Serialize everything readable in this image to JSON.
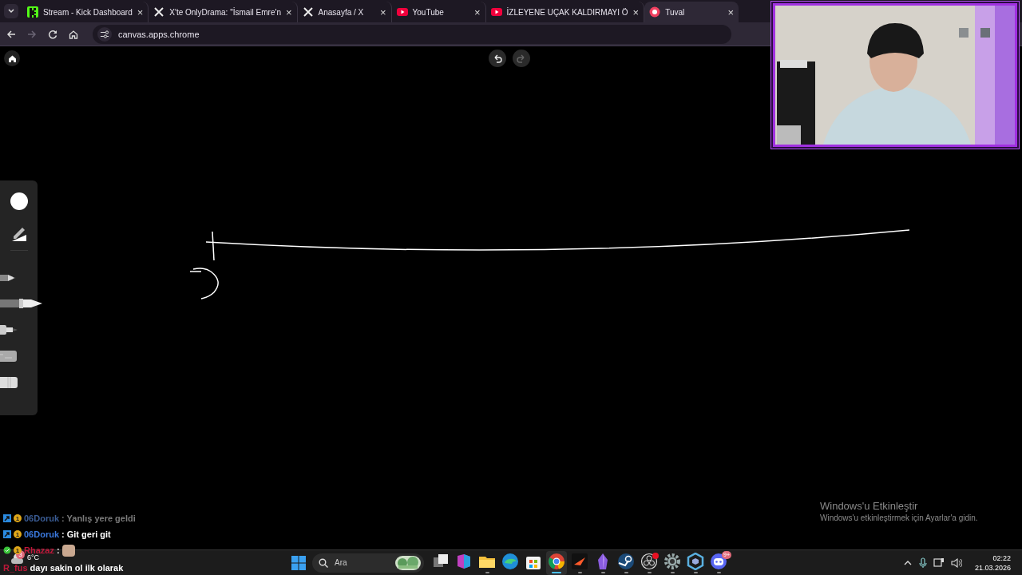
{
  "browser": {
    "tabs": [
      {
        "title": "Stream - Kick Dashboard",
        "kind": "kick",
        "selected": false
      },
      {
        "title": "X'te OnlyDrama: \"İsmail Emre'n",
        "kind": "x",
        "selected": false
      },
      {
        "title": "Anasayfa / X",
        "kind": "x",
        "selected": false
      },
      {
        "title": "YouTube",
        "kind": "youtube",
        "selected": false
      },
      {
        "title": "İZLEYENE UÇAK KALDIRMAYI Ö",
        "kind": "youtube",
        "selected": false
      },
      {
        "title": "Tuval",
        "kind": "canvas",
        "selected": true
      }
    ],
    "close_label": "×",
    "forward": {
      "disabled": true
    },
    "address": "canvas.apps.chrome"
  },
  "canvas_app": {
    "undo": {
      "disabled": false
    },
    "redo": {
      "disabled": true
    },
    "controls": [
      {
        "kind": "color"
      },
      {
        "kind": "ruler"
      }
    ],
    "tools": [
      {
        "kind": "pencil",
        "selected": false
      },
      {
        "kind": "pen",
        "selected": true
      },
      {
        "kind": "marker",
        "selected": false
      },
      {
        "kind": "chalk",
        "selected": false
      },
      {
        "kind": "eraser",
        "selected": false
      }
    ]
  },
  "chat": [
    {
      "kind": "mod",
      "badge": "1",
      "user": "06Doruk",
      "color": "#3a5c94",
      "text": ": Yanlış yere geldi",
      "faded": true
    },
    {
      "kind": "mod",
      "badge": "1",
      "user": "06Doruk",
      "color": "#3a78dc",
      "text": ": Git geri git",
      "faded": false
    },
    {
      "kind": "verified",
      "badge": "1",
      "user": "Rhazaz",
      "color": "#c0183a",
      "text": ":",
      "emote": true,
      "faded": false
    },
    {
      "user": "R_fus",
      "color": "#c0183a",
      "text": "dayı sakin ol ilk olarak",
      "faded": false
    }
  ],
  "activation": {
    "title": "Windows'u Etkinleştir",
    "subtitle": "Windows'u etkinleştirmek için Ayarlar'a gidin."
  },
  "taskbar": {
    "weather": {
      "temperature": "6°C",
      "badge": "3"
    },
    "search": {
      "placeholder": "Ara"
    },
    "apps": [
      {
        "kind": "task-view",
        "running": false,
        "active": false
      },
      {
        "kind": "office",
        "running": false,
        "active": false
      },
      {
        "kind": "folder",
        "running": true,
        "active": false
      },
      {
        "kind": "wave",
        "running": false,
        "active": false
      },
      {
        "kind": "store",
        "running": false,
        "active": false
      },
      {
        "kind": "browser",
        "running": true,
        "active": true
      },
      {
        "kind": "arrow",
        "running": true,
        "active": false
      },
      {
        "kind": "crystal",
        "running": true,
        "active": false
      },
      {
        "kind": "piston",
        "running": true,
        "active": false
      },
      {
        "kind": "record",
        "running": true,
        "active": false,
        "alert": true
      },
      {
        "kind": "settings",
        "running": true,
        "active": false
      },
      {
        "kind": "cube",
        "running": true,
        "active": false
      },
      {
        "kind": "chat",
        "running": true,
        "active": false,
        "badge": "9+"
      }
    ],
    "clock": {
      "time": "02:22",
      "date": "21.03.2026"
    }
  }
}
